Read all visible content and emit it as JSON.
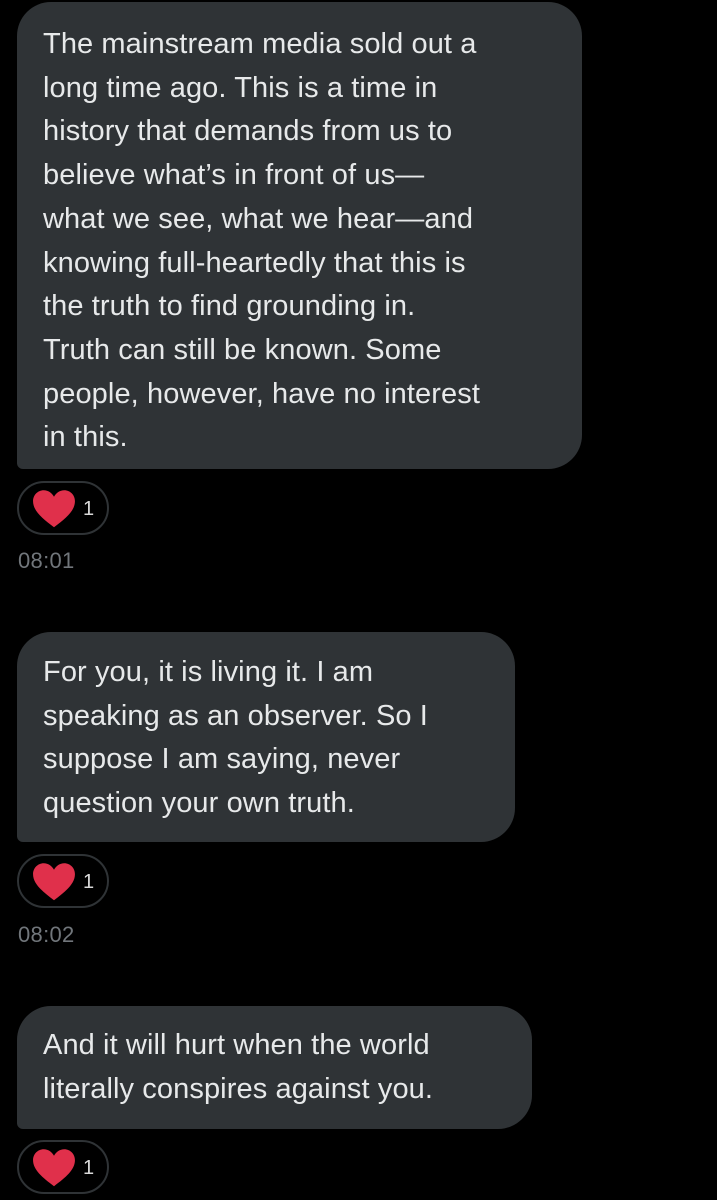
{
  "messages": [
    {
      "lines": [
        "The mainstream media sold out a",
        "long time ago. This is a time in",
        "history that demands from us to",
        "believe what’s in front of us—",
        "what we see, what we hear—and",
        "knowing full-heartedly that this is",
        "the truth to find grounding in.",
        "Truth can still be known. Some",
        "people, however, have no interest",
        "in this."
      ],
      "reaction": {
        "icon": "heart-icon",
        "count": "1"
      },
      "time": "08:01"
    },
    {
      "lines": [
        "For you, it is living it. I am",
        "speaking as an observer. So I",
        "suppose I am saying, never",
        "question your own truth."
      ],
      "reaction": {
        "icon": "heart-icon",
        "count": "1"
      },
      "time": "08:02"
    },
    {
      "lines": [
        "And it will hurt when the world",
        "literally conspires against you."
      ],
      "reaction": {
        "icon": "heart-icon",
        "count": "1"
      }
    }
  ],
  "colors": {
    "background": "#000000",
    "bubble": "#2f3336",
    "text": "#e7e9ea",
    "heart": "#e0304b",
    "timestamp": "#71767b"
  }
}
